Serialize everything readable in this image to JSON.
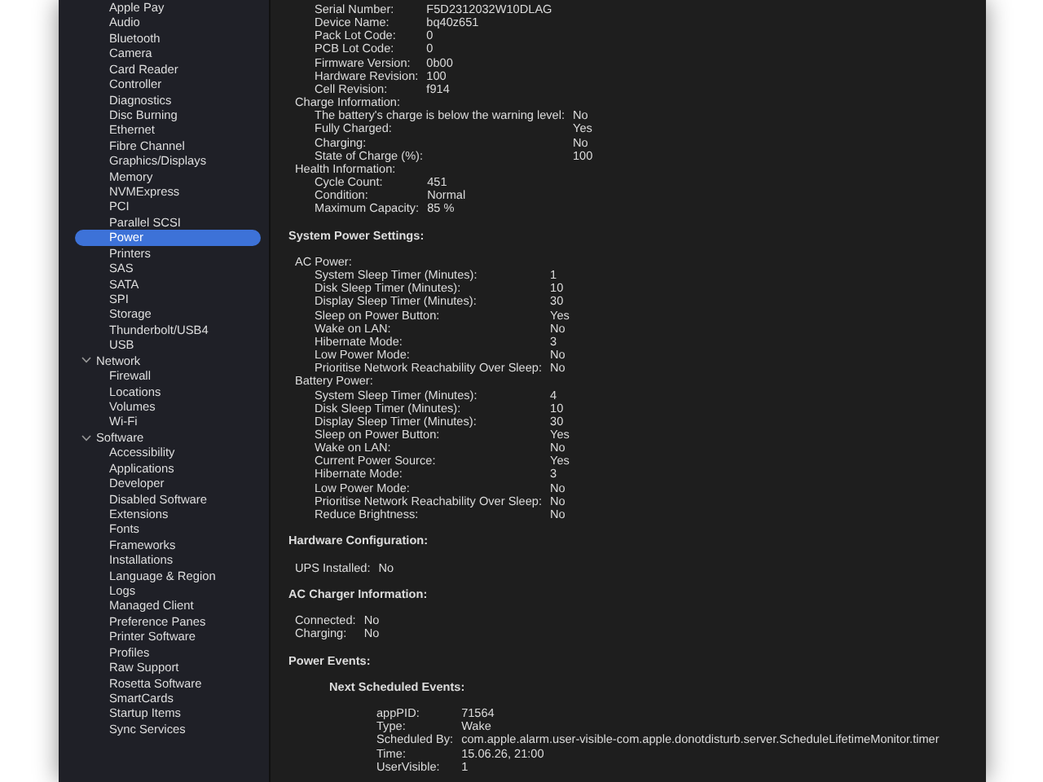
{
  "sidebar": {
    "groups": [
      {
        "items": [
          {
            "label": "Apple Pay",
            "selected": false
          },
          {
            "label": "Audio",
            "selected": false
          },
          {
            "label": "Bluetooth",
            "selected": false
          },
          {
            "label": "Camera",
            "selected": false
          },
          {
            "label": "Card Reader",
            "selected": false
          },
          {
            "label": "Controller",
            "selected": false
          },
          {
            "label": "Diagnostics",
            "selected": false
          },
          {
            "label": "Disc Burning",
            "selected": false
          },
          {
            "label": "Ethernet",
            "selected": false
          },
          {
            "label": "Fibre Channel",
            "selected": false
          },
          {
            "label": "Graphics/Displays",
            "selected": false
          },
          {
            "label": "Memory",
            "selected": false
          },
          {
            "label": "NVMExpress",
            "selected": false
          },
          {
            "label": "PCI",
            "selected": false
          },
          {
            "label": "Parallel SCSI",
            "selected": false
          },
          {
            "label": "Power",
            "selected": true
          },
          {
            "label": "Printers",
            "selected": false
          },
          {
            "label": "SAS",
            "selected": false
          },
          {
            "label": "SATA",
            "selected": false
          },
          {
            "label": "SPI",
            "selected": false
          },
          {
            "label": "Storage",
            "selected": false
          },
          {
            "label": "Thunderbolt/USB4",
            "selected": false
          },
          {
            "label": "USB",
            "selected": false
          }
        ]
      },
      {
        "label": "Network",
        "expanded": true,
        "items": [
          {
            "label": "Firewall",
            "selected": false
          },
          {
            "label": "Locations",
            "selected": false
          },
          {
            "label": "Volumes",
            "selected": false
          },
          {
            "label": "Wi-Fi",
            "selected": false
          }
        ]
      },
      {
        "label": "Software",
        "expanded": true,
        "items": [
          {
            "label": "Accessibility",
            "selected": false
          },
          {
            "label": "Applications",
            "selected": false
          },
          {
            "label": "Developer",
            "selected": false
          },
          {
            "label": "Disabled Software",
            "selected": false
          },
          {
            "label": "Extensions",
            "selected": false
          },
          {
            "label": "Fonts",
            "selected": false
          },
          {
            "label": "Frameworks",
            "selected": false
          },
          {
            "label": "Installations",
            "selected": false
          },
          {
            "label": "Language & Region",
            "selected": false
          },
          {
            "label": "Logs",
            "selected": false
          },
          {
            "label": "Managed Client",
            "selected": false
          },
          {
            "label": "Preference Panes",
            "selected": false
          },
          {
            "label": "Printer Software",
            "selected": false
          },
          {
            "label": "Profiles",
            "selected": false
          },
          {
            "label": "Raw Support",
            "selected": false
          },
          {
            "label": "Rosetta Software",
            "selected": false
          },
          {
            "label": "SmartCards",
            "selected": false
          },
          {
            "label": "Startup Items",
            "selected": false
          },
          {
            "label": "Sync Services",
            "selected": false
          }
        ]
      }
    ]
  },
  "content": {
    "sections": [
      {
        "groups": [
          {
            "kind": "plain",
            "fields": [
              {
                "label": "Serial Number:",
                "value": "F5D2312032W10DLAG"
              },
              {
                "label": "Device Name:",
                "value": "bq40z651"
              },
              {
                "label": "Pack Lot Code:",
                "value": "0"
              },
              {
                "label": "PCB Lot Code:",
                "value": "0"
              },
              {
                "label": "Firmware Version:",
                "value": "0b00"
              },
              {
                "label": "Hardware Revision:",
                "value": "100"
              },
              {
                "label": "Cell Revision:",
                "value": "f914"
              }
            ]
          },
          {
            "kind": "plain",
            "title": "Charge Information:",
            "fields": [
              {
                "label": "The battery's charge is below the warning level:",
                "value": "No"
              },
              {
                "label": "Fully Charged:",
                "value": "Yes"
              },
              {
                "label": "Charging:",
                "value": "No"
              },
              {
                "label": "State of Charge (%):",
                "value": "100"
              }
            ]
          },
          {
            "kind": "plain",
            "title": "Health Information:",
            "fields": [
              {
                "label": "Cycle Count:",
                "value": "451"
              },
              {
                "label": "Condition:",
                "value": "Normal"
              },
              {
                "label": "Maximum Capacity:",
                "value": "85 %"
              }
            ]
          }
        ]
      },
      {
        "title": "System Power Settings:",
        "groups": [
          {
            "kind": "plain",
            "title": "AC Power:",
            "fields": [
              {
                "label": "System Sleep Timer (Minutes):",
                "value": "1"
              },
              {
                "label": "Disk Sleep Timer (Minutes):",
                "value": "10"
              },
              {
                "label": "Display Sleep Timer (Minutes):",
                "value": "30"
              },
              {
                "label": "Sleep on Power Button:",
                "value": "Yes"
              },
              {
                "label": "Wake on LAN:",
                "value": "No"
              },
              {
                "label": "Hibernate Mode:",
                "value": "3"
              },
              {
                "label": "Low Power Mode:",
                "value": "No"
              },
              {
                "label": "Prioritise Network Reachability Over Sleep:",
                "value": "No"
              }
            ]
          },
          {
            "kind": "plain",
            "title": "Battery Power:",
            "fields": [
              {
                "label": "System Sleep Timer (Minutes):",
                "value": "4"
              },
              {
                "label": "Disk Sleep Timer (Minutes):",
                "value": "10"
              },
              {
                "label": "Display Sleep Timer (Minutes):",
                "value": "30"
              },
              {
                "label": "Sleep on Power Button:",
                "value": "Yes"
              },
              {
                "label": "Wake on LAN:",
                "value": "No"
              },
              {
                "label": "Current Power Source:",
                "value": "Yes"
              },
              {
                "label": "Hibernate Mode:",
                "value": "3"
              },
              {
                "label": "Low Power Mode:",
                "value": "No"
              },
              {
                "label": "Prioritise Network Reachability Over Sleep:",
                "value": "No"
              },
              {
                "label": "Reduce Brightness:",
                "value": "No"
              }
            ]
          }
        ]
      },
      {
        "title": "Hardware Configuration:",
        "groups": [
          {
            "kind": "plain",
            "fields": [
              {
                "label": "UPS Installed:",
                "value": "No"
              }
            ]
          }
        ]
      },
      {
        "title": "AC Charger Information:",
        "groups": [
          {
            "kind": "plain",
            "fields": [
              {
                "label": "Connected:",
                "value": "No"
              },
              {
                "label": "Charging:",
                "value": "No"
              }
            ]
          }
        ]
      },
      {
        "title": "Power Events:",
        "groups": [
          {
            "kind": "subheading",
            "title": "Next Scheduled Events:",
            "fields": [
              {
                "label": "appPID:",
                "value": "71564"
              },
              {
                "label": "Type:",
                "value": "Wake"
              },
              {
                "label": "Scheduled By:",
                "value": "com.apple.alarm.user-visible-com.apple.donotdisturb.server.ScheduleLifetimeMonitor.timer"
              },
              {
                "label": "Time:",
                "value": "15.06.26, 21:00"
              },
              {
                "label": "UserVisible:",
                "value": "1"
              }
            ]
          }
        ]
      }
    ]
  }
}
